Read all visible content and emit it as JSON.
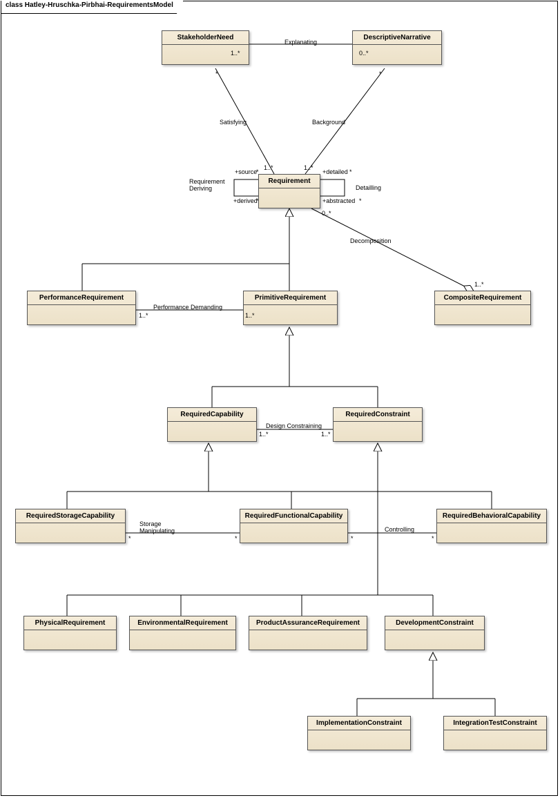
{
  "title": "class Hatley-Hruschka-Pirbhai-RequirementsModel",
  "classes": {
    "StakeholderNeed": "StakeholderNeed",
    "DescriptiveNarrative": "DescriptiveNarrative",
    "Requirement": "Requirement",
    "PerformanceRequirement": "PerformanceRequirement",
    "PrimitiveRequirement": "PrimitiveRequirement",
    "CompositeRequirement": "CompositeRequirement",
    "RequiredCapability": "RequiredCapability",
    "RequiredConstraint": "RequiredConstraint",
    "RequiredStorageCapability": "RequiredStorageCapability",
    "RequiredFunctionalCapability": "RequiredFunctionalCapability",
    "RequiredBehavioralCapability": "RequiredBehavioralCapability",
    "PhysicalRequirement": "PhysicalRequirement",
    "EnvironmentalRequirement": "EnvironmentalRequirement",
    "ProductAssuranceRequirement": "ProductAssuranceRequirement",
    "DevelopmentConstraint": "DevelopmentConstraint",
    "ImplementationConstraint": "ImplementationConstraint",
    "IntegrationTestConstraint": "IntegrationTestConstraint"
  },
  "associations": {
    "Explanating": "Explanating",
    "Satisfying": "Satisfying",
    "Background": "Background",
    "RequirementDeriving": "Requirement Deriving",
    "Detailling": "Detailling",
    "Decomposition": "Decomposition",
    "PerformanceDemanding": "Performance Demanding",
    "DesignConstraining": "Design Constraining",
    "StorageManipulating": "Storage Manipulating",
    "Controlling": "Controlling"
  },
  "roles": {
    "source": "+source",
    "derived": "+derived",
    "detailed": "+detailed",
    "abstracted": "+abstracted"
  },
  "mult": {
    "one_star": "1..*",
    "zero_star": "0..*",
    "star": "*"
  }
}
